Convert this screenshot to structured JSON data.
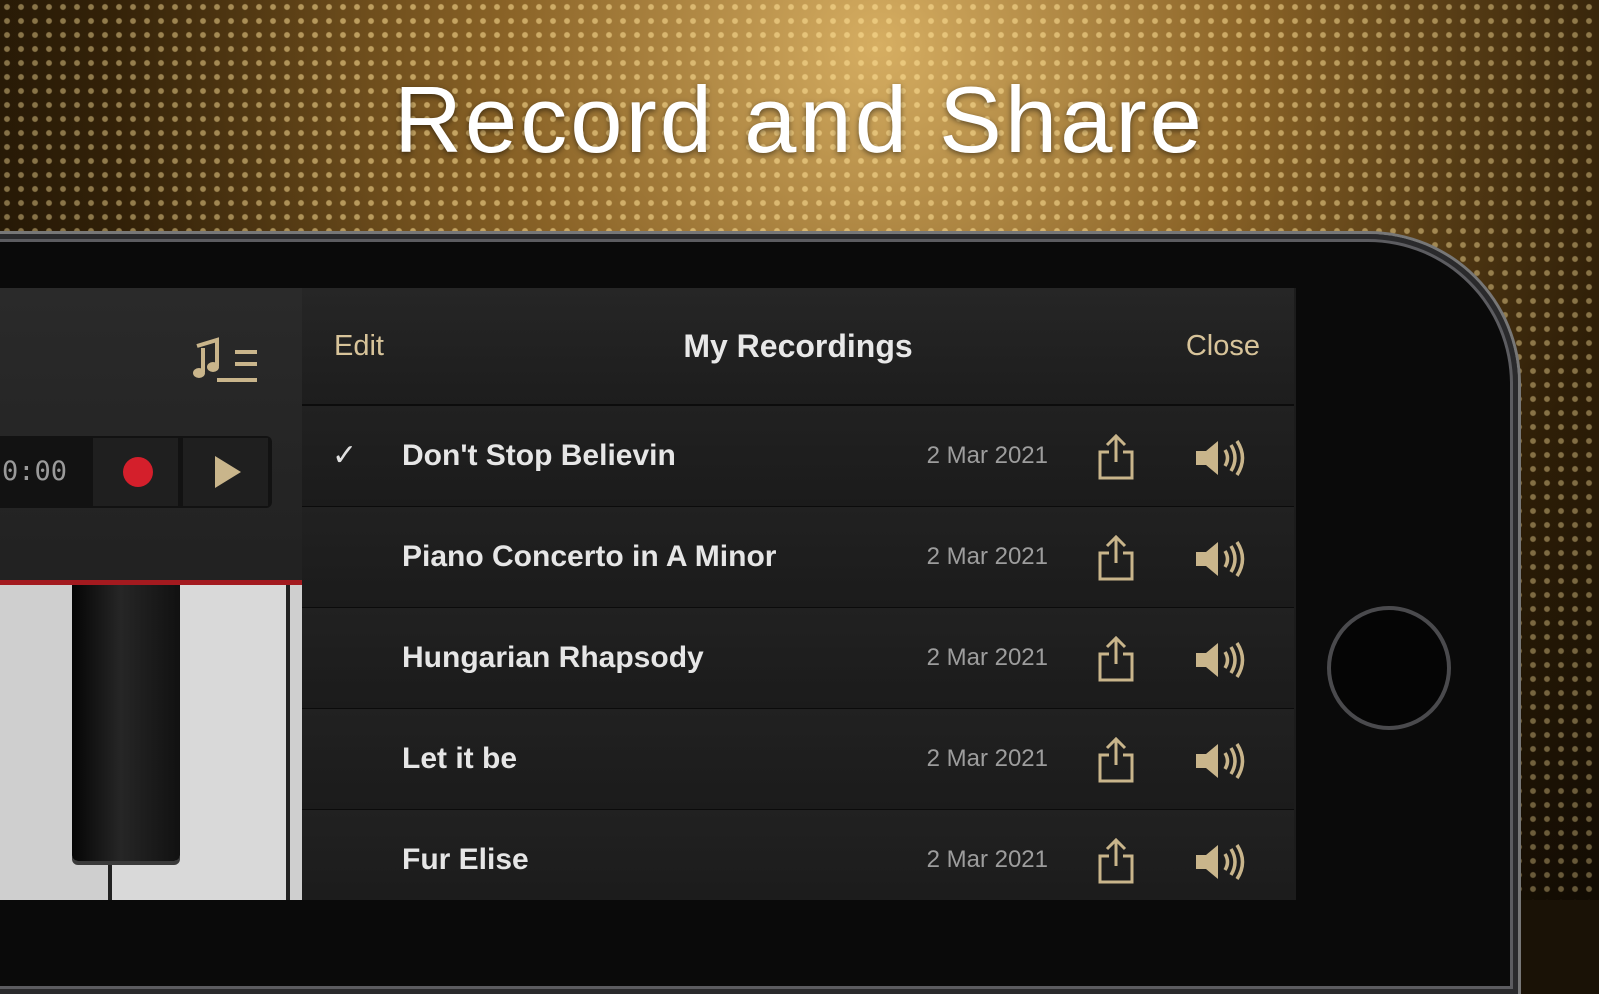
{
  "headline": "Record and Share",
  "piano": {
    "timer": "0:00"
  },
  "recordings": {
    "edit_label": "Edit",
    "title": "My Recordings",
    "close_label": "Close",
    "items": [
      {
        "title": "Don't Stop Believin",
        "date": "2 Mar 2021",
        "selected": true
      },
      {
        "title": "Piano Concerto in A Minor",
        "date": "2 Mar 2021",
        "selected": false
      },
      {
        "title": "Hungarian Rhapsody",
        "date": "2 Mar 2021",
        "selected": false
      },
      {
        "title": "Let it be",
        "date": "2 Mar 2021",
        "selected": false
      },
      {
        "title": "Fur Elise",
        "date": "2 Mar 2021",
        "selected": false
      }
    ],
    "check_glyph": "✓"
  },
  "colors": {
    "accent": "#d8c49a",
    "record": "#d41f2b"
  },
  "icons": [
    "song-list-icon",
    "record-icon",
    "play-icon",
    "share-icon",
    "speaker-icon",
    "checkmark-icon"
  ]
}
